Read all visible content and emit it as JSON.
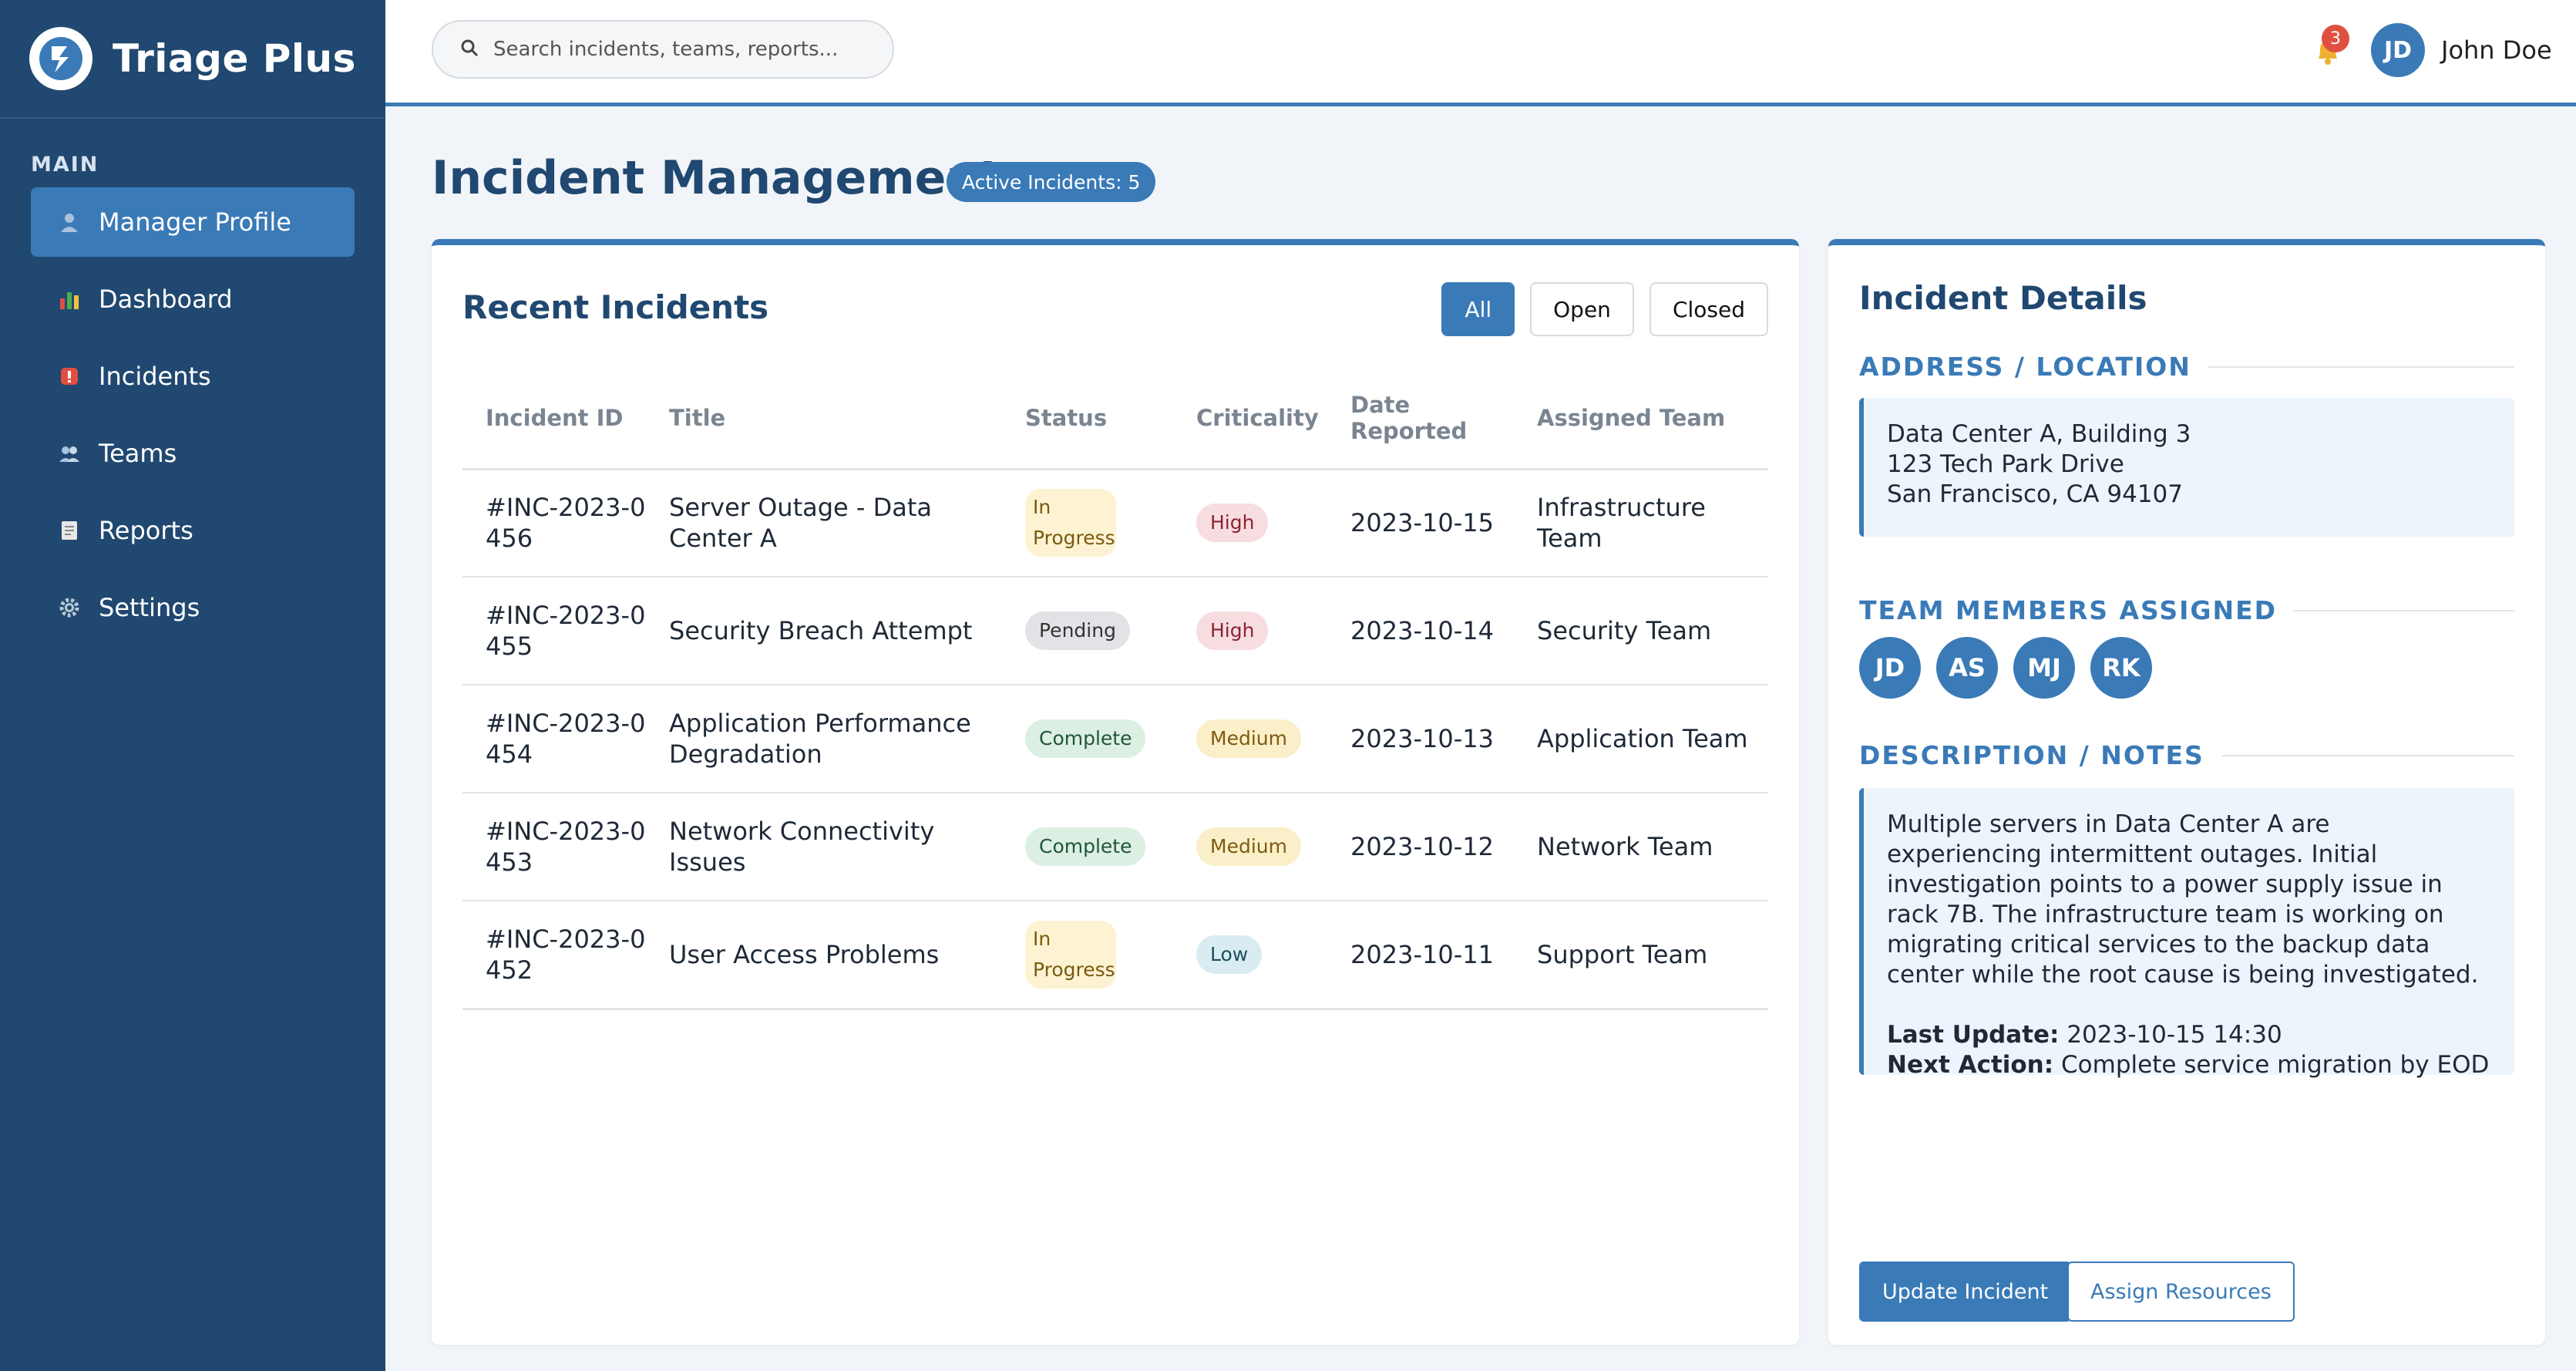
{
  "app": {
    "name": "Triage Plus"
  },
  "sidebar": {
    "section_label": "MAIN",
    "items": [
      {
        "label": "Manager Profile",
        "icon": "user-icon",
        "active": true
      },
      {
        "label": "Dashboard",
        "icon": "chart-icon",
        "active": false
      },
      {
        "label": "Incidents",
        "icon": "alert-icon",
        "active": false
      },
      {
        "label": "Teams",
        "icon": "team-icon",
        "active": false
      },
      {
        "label": "Reports",
        "icon": "report-icon",
        "active": false
      },
      {
        "label": "Settings",
        "icon": "gear-icon",
        "active": false
      }
    ]
  },
  "header": {
    "search_placeholder": "Search incidents, teams, reports...",
    "notification_count": "3",
    "user_initials": "JD",
    "user_name": "John Doe"
  },
  "page": {
    "title": "Incident Management",
    "badge": "Active Incidents: 5"
  },
  "incidents": {
    "title": "Recent Incidents",
    "filters": [
      "All",
      "Open",
      "Closed"
    ],
    "active_filter": "All",
    "columns": [
      "Incident ID",
      "Title",
      "Status",
      "Criticality",
      "Date Reported",
      "Assigned Team"
    ],
    "rows": [
      {
        "id": "#INC-2023-0456",
        "title": "Server Outage - Data Center A",
        "status": "In Progress",
        "criticality": "High",
        "date": "2023-10-15",
        "team": "Infrastructure Team"
      },
      {
        "id": "#INC-2023-0455",
        "title": "Security Breach Attempt",
        "status": "Pending",
        "criticality": "High",
        "date": "2023-10-14",
        "team": "Security Team"
      },
      {
        "id": "#INC-2023-0454",
        "title": "Application Performance Degradation",
        "status": "Complete",
        "criticality": "Medium",
        "date": "2023-10-13",
        "team": "Application Team"
      },
      {
        "id": "#INC-2023-0453",
        "title": "Network Connectivity Issues",
        "status": "Complete",
        "criticality": "Medium",
        "date": "2023-10-12",
        "team": "Network Team"
      },
      {
        "id": "#INC-2023-0452",
        "title": "User Access Problems",
        "status": "In Progress",
        "criticality": "Low",
        "date": "2023-10-11",
        "team": "Support Team"
      }
    ]
  },
  "details": {
    "title": "Incident Details",
    "address_heading": "ADDRESS / LOCATION",
    "address_lines": [
      "Data Center A, Building 3",
      "123 Tech Park Drive",
      "San Francisco, CA 94107"
    ],
    "team_heading": "TEAM MEMBERS ASSIGNED",
    "members": [
      "JD",
      "AS",
      "MJ",
      "RK"
    ],
    "notes_heading": "DESCRIPTION / NOTES",
    "notes_text": "Multiple servers in Data Center A are experiencing intermittent outages. Initial investigation points to a power supply issue in rack 7B. The infrastructure team is working on migrating critical services to the backup data center while the root cause is being investigated.",
    "last_update_label": "Last Update:",
    "last_update_value": "2023-10-15 14:30",
    "next_action_label": "Next Action:",
    "next_action_value": "Complete service migration by EOD",
    "primary_button": "Update Incident",
    "secondary_button": "Assign Resources"
  },
  "colors": {
    "sidebar_bg": "#204870",
    "accent": "#3a7ab7",
    "title": "#204870"
  }
}
